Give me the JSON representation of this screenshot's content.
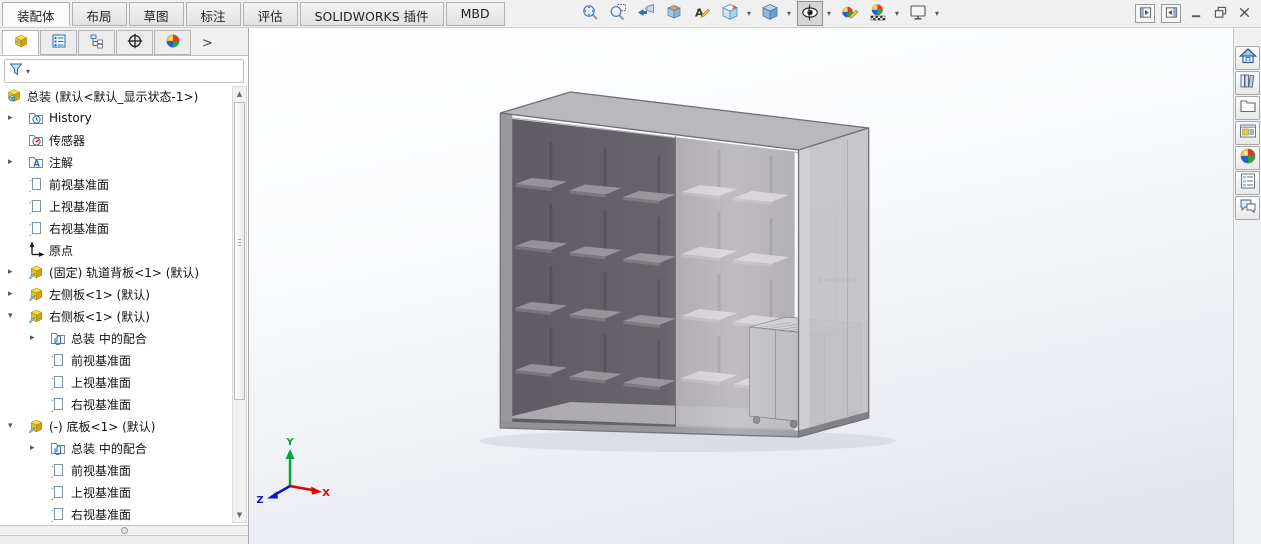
{
  "command_tabs": {
    "items": [
      {
        "label": "装配体",
        "active": true
      },
      {
        "label": "布局",
        "active": false
      },
      {
        "label": "草图",
        "active": false
      },
      {
        "label": "标注",
        "active": false
      },
      {
        "label": "评估",
        "active": false
      },
      {
        "label": "SOLIDWORKS 插件",
        "active": false
      },
      {
        "label": "MBD",
        "active": false
      }
    ]
  },
  "headsup_toolbar": {
    "buttons": [
      {
        "name": "zoom-to-fit",
        "icon": "zoomfit",
        "dropdown": false,
        "pressed": false
      },
      {
        "name": "zoom-to-area",
        "icon": "zoomarea",
        "dropdown": false,
        "pressed": false
      },
      {
        "name": "previous-view",
        "icon": "prevview",
        "dropdown": false,
        "pressed": false
      },
      {
        "name": "section-view",
        "icon": "section",
        "dropdown": false,
        "pressed": false
      },
      {
        "name": "dynamic-annotation-views",
        "icon": "annview",
        "dropdown": false,
        "pressed": false
      },
      {
        "name": "view-orientation",
        "icon": "vieworient",
        "dropdown": true,
        "pressed": false
      },
      {
        "name": "display-style",
        "icon": "dispstyle",
        "dropdown": true,
        "pressed": false
      },
      {
        "name": "hide-show-items",
        "icon": "eye",
        "dropdown": true,
        "pressed": true
      },
      {
        "name": "edit-appearance",
        "icon": "editapp",
        "dropdown": false,
        "pressed": false
      },
      {
        "name": "apply-scene",
        "icon": "applyscene",
        "dropdown": true,
        "pressed": false
      },
      {
        "name": "view-settings",
        "icon": "viewset",
        "dropdown": true,
        "pressed": false
      }
    ]
  },
  "window_controls": {
    "buttons": [
      {
        "name": "collapse-left-pane",
        "icon": "wleft",
        "boxed": true
      },
      {
        "name": "collapse-right-pane",
        "icon": "wright",
        "boxed": true
      },
      {
        "name": "minimize",
        "icon": "wmin",
        "boxed": false
      },
      {
        "name": "restore",
        "icon": "wrestore",
        "boxed": false
      },
      {
        "name": "close",
        "icon": "wclose",
        "boxed": false
      }
    ]
  },
  "left_panel": {
    "tabs": [
      {
        "name": "featuremanager-design-tree",
        "icon": "ptree",
        "active": true
      },
      {
        "name": "propertymanager",
        "icon": "plist",
        "active": false
      },
      {
        "name": "configurationmanager",
        "icon": "pconfig",
        "active": false
      },
      {
        "name": "dimxpertmanager",
        "icon": "pdim",
        "active": false
      },
      {
        "name": "displaymanager",
        "icon": "pdisplay",
        "active": false
      }
    ],
    "overflow_chevron": ">",
    "filter": {
      "icon": "funnel",
      "caret": "▾"
    },
    "tree": {
      "items": [
        {
          "depth": 0,
          "expander": "",
          "icon": "assembly",
          "label": "总装 (默认<默认_显示状态-1>)"
        },
        {
          "depth": 1,
          "expander": "collapsed",
          "icon": "history",
          "label": "History"
        },
        {
          "depth": 1,
          "expander": "",
          "icon": "sensors",
          "label": "传感器"
        },
        {
          "depth": 1,
          "expander": "collapsed",
          "icon": "annotations",
          "label": "注解"
        },
        {
          "depth": 1,
          "expander": "",
          "icon": "plane",
          "label": "前视基准面"
        },
        {
          "depth": 1,
          "expander": "",
          "icon": "plane",
          "label": "上视基准面"
        },
        {
          "depth": 1,
          "expander": "",
          "icon": "plane",
          "label": "右视基准面"
        },
        {
          "depth": 1,
          "expander": "",
          "icon": "origin",
          "label": "原点"
        },
        {
          "depth": 1,
          "expander": "collapsed",
          "icon": "part",
          "label": "(固定) 轨道背板<1> (默认)"
        },
        {
          "depth": 1,
          "expander": "collapsed",
          "icon": "part",
          "label": "左侧板<1> (默认)"
        },
        {
          "depth": 1,
          "expander": "expanded",
          "icon": "part",
          "label": "右侧板<1> (默认)"
        },
        {
          "depth": 2,
          "expander": "collapsed",
          "icon": "mates",
          "label": "总装 中的配合"
        },
        {
          "depth": 2,
          "expander": "",
          "icon": "plane",
          "label": "前视基准面"
        },
        {
          "depth": 2,
          "expander": "",
          "icon": "plane",
          "label": "上视基准面"
        },
        {
          "depth": 2,
          "expander": "",
          "icon": "plane",
          "label": "右视基准面"
        },
        {
          "depth": 1,
          "expander": "expanded",
          "icon": "part",
          "label": "(-) 底板<1> (默认)"
        },
        {
          "depth": 2,
          "expander": "collapsed",
          "icon": "mates",
          "label": "总装 中的配合"
        },
        {
          "depth": 2,
          "expander": "",
          "icon": "plane",
          "label": "前视基准面"
        },
        {
          "depth": 2,
          "expander": "",
          "icon": "plane",
          "label": "上视基准面"
        },
        {
          "depth": 2,
          "expander": "",
          "icon": "plane",
          "label": "右视基准面"
        }
      ]
    }
  },
  "viewport": {
    "triad": {
      "x_label": "X",
      "y_label": "Y",
      "z_label": "Z"
    }
  },
  "task_pane": {
    "buttons": [
      {
        "name": "solidworks-resources",
        "icon": "home"
      },
      {
        "name": "design-library",
        "icon": "library"
      },
      {
        "name": "file-explorer",
        "icon": "folder"
      },
      {
        "name": "view-palette",
        "icon": "palette"
      },
      {
        "name": "appearances-scenes",
        "icon": "sphere"
      },
      {
        "name": "custom-properties",
        "icon": "props"
      },
      {
        "name": "solidworks-forum",
        "icon": "forum"
      }
    ]
  },
  "colors": {
    "triad_x": "#e60000",
    "triad_y": "#00a33c",
    "triad_z": "#1414c8",
    "cabinet_dark_interior": "#57525b",
    "cabinet_light_interior": "#a3a0a7"
  }
}
